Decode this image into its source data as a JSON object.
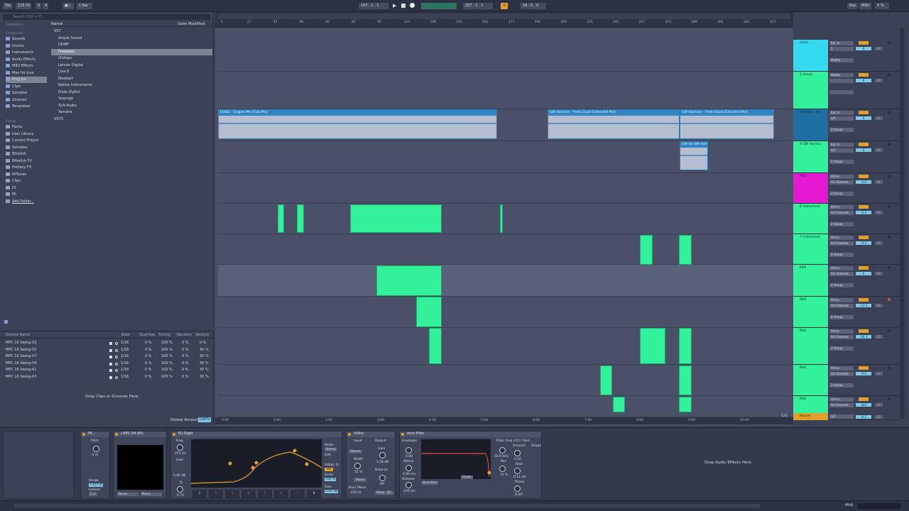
{
  "transport": {
    "tempo": "125.00",
    "time_sig_num": "4",
    "time_sig_den": "4",
    "quantize": "1 Bar",
    "position": "197 .  1 .  1",
    "loop_start": "257 .  1 .  1",
    "loop_length": "16 .  0 .  0",
    "key_label": "Key",
    "midi_label": "MIDI",
    "cpu": "4 %"
  },
  "browser": {
    "search_placeholder": "Search (Ctrl + F)",
    "collections_label": "Collections",
    "categories_label": "Categories",
    "places_label": "Places",
    "categories": [
      "Sounds",
      "Drums",
      "Instruments",
      "Audio Effects",
      "MIDI Effects",
      "Max for Live",
      "Plug-Ins",
      "Clips",
      "Samples",
      "Grooves",
      "Templates"
    ],
    "places": [
      "Packs",
      "User Library",
      "Current Project",
      "Samples",
      "Bthelick",
      "Bthelick FX",
      "Fre3ezy FX",
      "MiTunes",
      "Clips",
      "Dl",
      "Ml",
      "Add Folder..."
    ],
    "col_name": "Name",
    "col_date": "Date Modified",
    "items": [
      "VST",
      "Ample Sound",
      "DDMF",
      "Freeware",
      "iZotope",
      "Lennar Digital",
      "Line 6",
      "Moddart",
      "Native Instruments",
      "Slate Digital",
      "Voxengo",
      "XLN Audio",
      "Yamaha",
      "VST3"
    ]
  },
  "groove_pool": {
    "headers": [
      "Groove Name",
      "Base",
      "Quantize",
      "Timing",
      "Random",
      "Velocity"
    ],
    "rows": [
      {
        "name": "MPC 16 Swing-53",
        "base": "1/16",
        "quantize": "0 %",
        "timing": "100 %",
        "random": "0 %",
        "velocity": "0 %"
      },
      {
        "name": "MPC 16 Swing-55",
        "base": "1/16",
        "quantize": "0 %",
        "timing": "100 %",
        "random": "0 %",
        "velocity": "30 %"
      },
      {
        "name": "MPC 16 Swing-57",
        "base": "1/16",
        "quantize": "0 %",
        "timing": "100 %",
        "random": "0 %",
        "velocity": "30 %"
      },
      {
        "name": "MPC 16 Swing-59",
        "base": "1/16",
        "quantize": "0 %",
        "timing": "100 %",
        "random": "0 %",
        "velocity": "30 %"
      },
      {
        "name": "MPC 16 Swing-61",
        "base": "1/16",
        "quantize": "0 %",
        "timing": "100 %",
        "random": "0 %",
        "velocity": "30 %"
      },
      {
        "name": "MPC 16 Swing-63",
        "base": "1/16",
        "quantize": "0 %",
        "timing": "100 %",
        "random": "0 %",
        "velocity": "30 %"
      }
    ],
    "drop_hint": "Drop Clips or Grooves Here",
    "global_amount_label": "Global Amount",
    "global_amount": "100%"
  },
  "arrangement": {
    "bar_numbers": [
      "1",
      "17",
      "33",
      "49",
      "65",
      "81",
      "97",
      "113",
      "129",
      "145",
      "161",
      "177",
      "193",
      "209",
      "225",
      "241",
      "257",
      "273",
      "289",
      "305",
      "321",
      "337"
    ],
    "time_labels": [
      "0:00",
      "1:00",
      "2:00",
      "3:00",
      "4:00",
      "5:00",
      "6:00",
      "7:00",
      "8:00",
      "9:00",
      "10:00"
    ],
    "audio_clips": [
      {
        "name": "ESSEL - Forgive Me (Club Mix)"
      },
      {
        "name": "GW Harrison - Feels Good (Extended Mix)"
      },
      {
        "name": "GW Harrison - Feels Good (Extended Mix)"
      },
      {
        "name": "GW Ha GW Harri"
      }
    ],
    "zoom_label": "1/1"
  },
  "tracks": [
    {
      "name": "micIn",
      "color": "#35d9f0",
      "input": "Ext. In",
      "input2": "1",
      "routing": "Master",
      "volume": "0",
      "pan": "C"
    },
    {
      "name": "2 Group",
      "color": "#33f09a",
      "input": "Master",
      "input2": "",
      "routing": "",
      "volume": "0",
      "pan": "C"
    },
    {
      "name": "3 ESSEL - For",
      "color": "#1f6fa3",
      "input": "Ext. In",
      "input2": "1/2",
      "routing": "2-Group",
      "volume": "0",
      "pan": "C"
    },
    {
      "name": "4 GW Harriso",
      "color": "#33f09a",
      "input": "Ext. In",
      "input2": "1/2",
      "routing": "2-Group",
      "volume": "0",
      "pan": "C"
    },
    {
      "name": "Midi",
      "color": "#e31ad2",
      "input": "All Ins",
      "input2": "All Channels",
      "routing": "2-Group",
      "volume": "-2.0",
      "pan": "C"
    },
    {
      "name": "6 Instrument",
      "color": "#33f09a",
      "input": "All Ins",
      "input2": "All Channels",
      "routing": "2-Group",
      "volume": "-6.3",
      "pan": "C"
    },
    {
      "name": "7 Instrument",
      "color": "#33f09a",
      "input": "All Ins",
      "input2": "All Channels",
      "routing": "2-Group",
      "volume": "-4.3",
      "pan": "C"
    },
    {
      "name": "Midi",
      "color": "#33f09a",
      "input": "All Ins",
      "input2": "All Channels",
      "routing": "2-Group",
      "volume": "0",
      "pan": "C"
    },
    {
      "name": "Midi",
      "color": "#33f09a",
      "input": "All Ins",
      "input2": "All Channels",
      "routing": "2-Group",
      "volume": "-17.0",
      "pan": "C"
    },
    {
      "name": "Midi",
      "color": "#33f09a",
      "input": "All Ins",
      "input2": "All Channels",
      "routing": "2-Group",
      "volume": "-16.4",
      "pan": "C"
    },
    {
      "name": "Midi",
      "color": "#33f09a",
      "input": "All Ins",
      "input2": "All Channels",
      "routing": "2-Group",
      "volume": "-9.5",
      "pan": "C"
    },
    {
      "name": "Midi",
      "color": "#33f09a",
      "input": "All Ins",
      "input2": "All Channels",
      "routing": "2-Group",
      "volume": "-8.0",
      "pan": "C"
    }
  ],
  "master": {
    "name": "Master",
    "routing": "1/2",
    "volume": "-6.1",
    "pan": "C"
  },
  "devices": {
    "pitch": {
      "title": "Pit...",
      "pitch_label": "Pitch",
      "pitch_value": "-2 st",
      "range_label": "Range",
      "range_value": "+127 st",
      "lowest_label": "Lowest",
      "lowest_value": "C-2"
    },
    "labs": {
      "title": "LABS (64 Bit)",
      "none1": "None",
      "none2": "None"
    },
    "eq": {
      "title": "EQ Eight",
      "freq_label": "Freq",
      "freq_value": "375 Hz",
      "gain_label": "Gain",
      "gain_value": "0.00 dB",
      "q_label": "Q",
      "q_value": "0.75",
      "mode_label": "Mode",
      "mode_value": "Stereo",
      "edit_label": "Edit",
      "adapt_label": "Adapt. Q",
      "adapt_value": "On",
      "scale_label": "Scale",
      "scale_value": "100 %",
      "gain2_label": "Gain",
      "gain2_value": "0.00 dB",
      "band_numbers": [
        "1",
        "2",
        "3",
        "4",
        "5",
        "6",
        "7",
        "8"
      ]
    },
    "utility": {
      "title": "Utility",
      "input_label": "Input",
      "output_label": "Output",
      "stereo_label": "Stereo",
      "gain_label": "Gain",
      "gain_value": "5.58 dB",
      "width_label": "Width",
      "width_value": "31 %",
      "balance_label": "Balance",
      "balance_value": "6R",
      "mono_label": "Mono",
      "bass_mono_label": "Bass Mono",
      "bass_freq": "120 Hz",
      "mute_label": "Mute",
      "dc_label": "DC"
    },
    "autofilter": {
      "title": "Auto Filter",
      "envelope_label": "Envelope",
      "env_value": "0.00",
      "attack_label": "Attack",
      "attack_value": "6.00 ms",
      "release_label": "Release",
      "release_value": "200 ms",
      "filter_freq_label": "Filter Freq",
      "filter_freq_value": "18.9 kHz",
      "res_label": "Res",
      "res_value": "14 %",
      "lfo_label": "LFO / S&H",
      "amount_label": "Amount",
      "amount_value": "0.00",
      "shape_label": "Shape",
      "rate_label": "Rate",
      "rate_value": "0.11 Hz",
      "phase_label": "Phase",
      "phase_value": "0.00°",
      "quantize_label": "Quantize",
      "clean_label": "Clean"
    },
    "drop_hint": "Drop Audio Effects Here"
  },
  "status": {
    "midi_label": "Midi"
  }
}
